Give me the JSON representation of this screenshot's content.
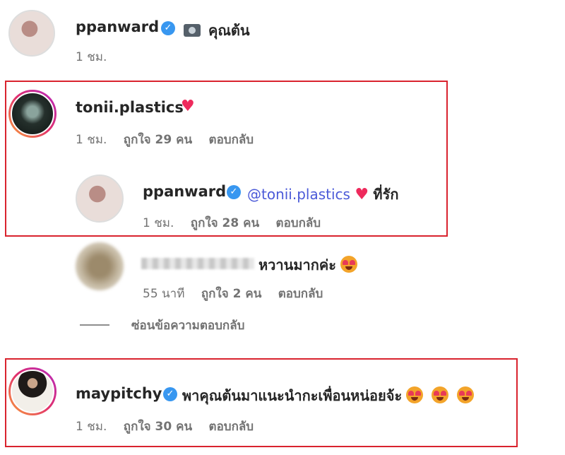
{
  "comments": [
    {
      "username": "ppanward",
      "verified": true,
      "text": "คุณต้น",
      "time": "1 ชม."
    },
    {
      "username": "tonii.plastics",
      "verified": false,
      "text": "",
      "time": "1 ชม.",
      "likes": "ถูกใจ 29 คน",
      "reply": "ตอบกลับ",
      "replies": [
        {
          "username": "ppanward",
          "verified": true,
          "mention": "@tonii.plastics",
          "text": "ที่รัก",
          "time": "1 ชม.",
          "likes": "ถูกใจ 28 คน",
          "reply": "ตอบกลับ"
        },
        {
          "username_blurred": true,
          "text": "หวานมากค่ะ",
          "time": "55 นาที",
          "likes": "ถูกใจ 2 คน",
          "reply": "ตอบกลับ"
        }
      ],
      "hide_replies": "ซ่อนข้อความตอบกลับ"
    },
    {
      "username": "maypitchy",
      "verified": true,
      "text": "พาคุณต้นมาแนะนำกะเพื่อนหน่อยจ้ะ",
      "time": "1 ชม.",
      "likes": "ถูกใจ 30 คน",
      "reply": "ตอบกลับ"
    }
  ],
  "colors": {
    "highlight_border": "#d9232e",
    "verified_badge": "#3897f0",
    "mention": "#4b5ad8",
    "heart": "#ee2a5c"
  },
  "icons": [
    "verified-badge-icon",
    "camera-icon",
    "heart-icon",
    "heart-eyes-emoji-icon"
  ]
}
